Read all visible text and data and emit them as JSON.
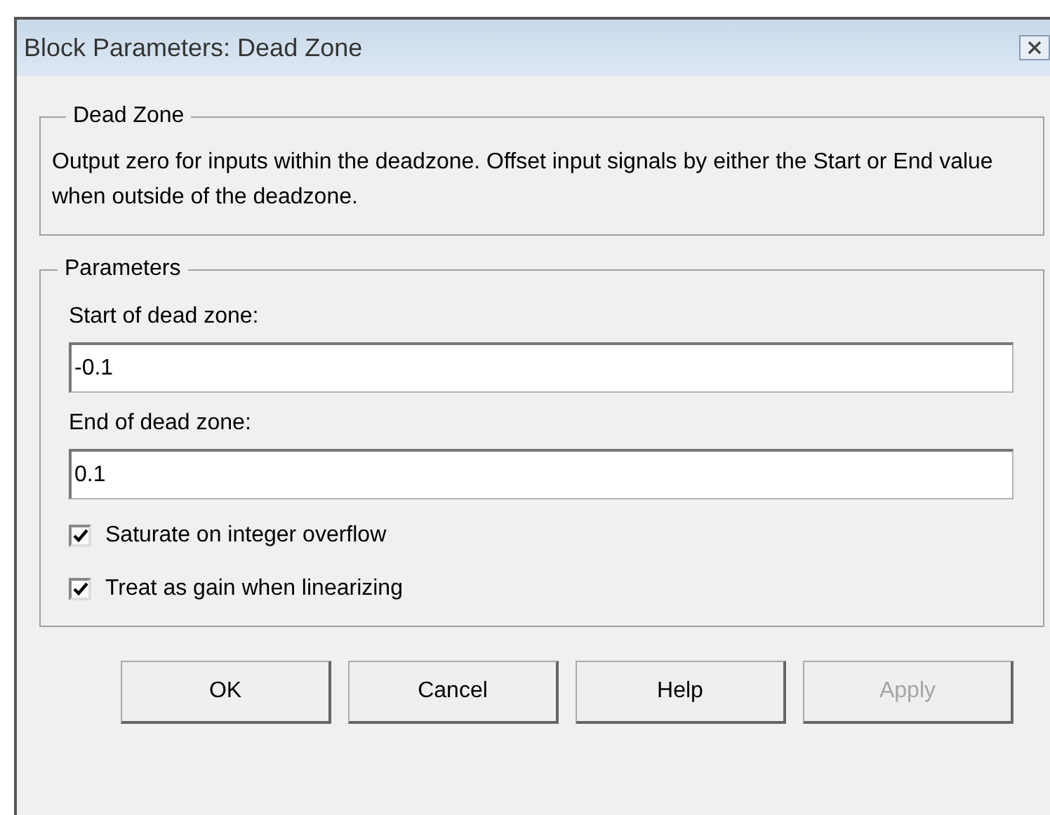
{
  "window": {
    "title": "Block Parameters: Dead Zone"
  },
  "description_group": {
    "title": "Dead Zone",
    "text": "Output zero for inputs within the deadzone.  Offset input signals by either the Start or End value when outside of the deadzone."
  },
  "parameters_group": {
    "title": "Parameters",
    "fields": [
      {
        "label": "Start of dead zone:",
        "value": "-0.1"
      },
      {
        "label": "End of dead zone:",
        "value": "0.1"
      }
    ],
    "checkboxes": [
      {
        "label": "Saturate on integer overflow",
        "checked": true
      },
      {
        "label": "Treat as gain when linearizing",
        "checked": true
      }
    ]
  },
  "buttons": [
    {
      "label": "OK",
      "disabled": false
    },
    {
      "label": "Cancel",
      "disabled": false
    },
    {
      "label": "Help",
      "disabled": false
    },
    {
      "label": "Apply",
      "disabled": true
    }
  ]
}
